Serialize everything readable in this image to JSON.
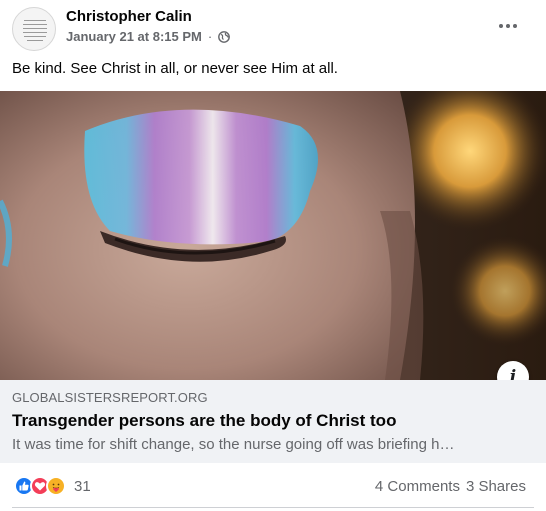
{
  "post": {
    "author": "Christopher Calin",
    "date": "January 21 at 8:15 PM",
    "separator": "·",
    "audience_icon": "globe-icon",
    "more_icon": "more-options-icon",
    "message": "Be kind. See Christ in all, or never see Him at all."
  },
  "link_preview": {
    "info_icon_glyph": "i",
    "domain": "GLOBALSISTERSREPORT.ORG",
    "title": "Transgender persons are the body of Christ too",
    "description": "It was time for shift change, so the nurse going off was briefing h…"
  },
  "footer": {
    "reaction_icons": [
      "like-icon",
      "love-icon",
      "care-icon"
    ],
    "reaction_count": "31",
    "comments": "4 Comments",
    "shares": "3 Shares"
  },
  "colors": {
    "like_blue": "#1877f2",
    "love_red": "#f33e58",
    "care_yellow": "#f7b125",
    "secondary_text": "#65676b",
    "link_bg": "#f0f2f5"
  }
}
